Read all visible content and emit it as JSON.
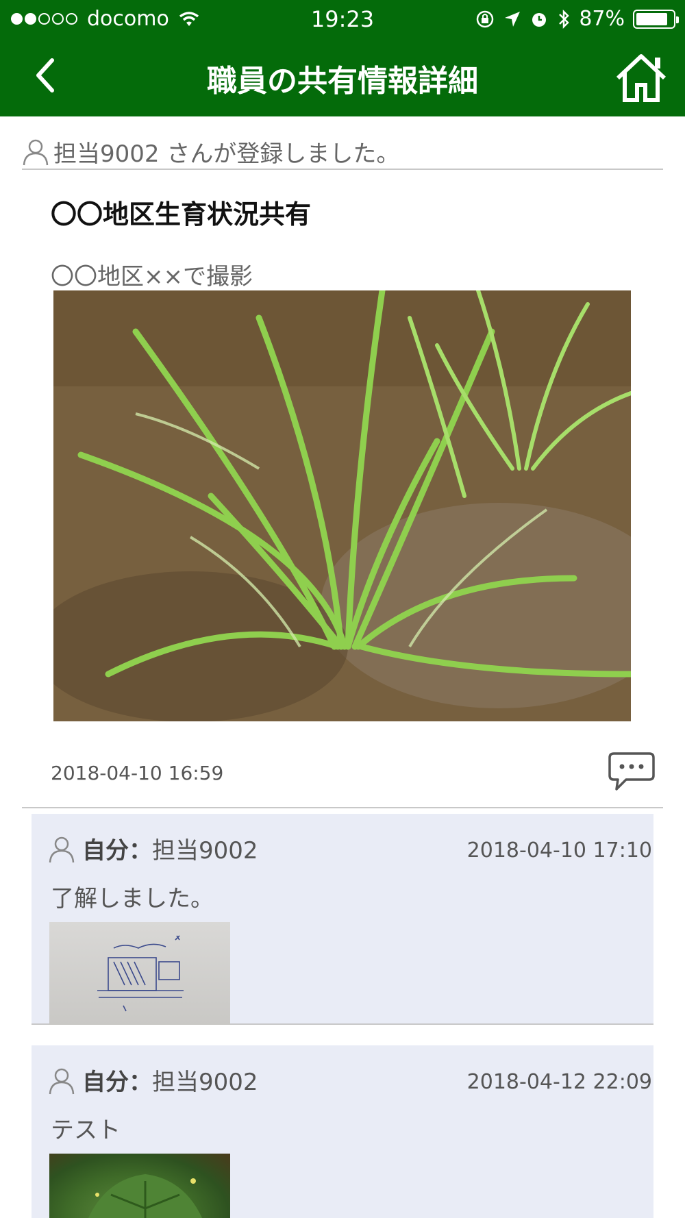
{
  "status_bar": {
    "carrier": "docomo",
    "time": "19:23",
    "battery_text": "87%",
    "battery_level": 0.87
  },
  "nav": {
    "title": "職員の共有情報詳細",
    "back_icon": "chevron-left-icon",
    "home_icon": "home-icon"
  },
  "post": {
    "author_text": "担当9002 さんが登録しました。",
    "title": "〇〇地区生育状況共有",
    "caption": "〇〇地区××で撮影",
    "date": "2018-04-10 16:59"
  },
  "comments": [
    {
      "self_label": "自分：",
      "author": "担当9002",
      "timestamp": "2018-04-10 17:10",
      "message": "了解しました。"
    },
    {
      "self_label": "自分：",
      "author": "担当9002",
      "timestamp": "2018-04-12 22:09",
      "message": "テスト"
    }
  ],
  "colors": {
    "header_green": "#046b0a",
    "comment_bg": "#e9ecf6"
  }
}
